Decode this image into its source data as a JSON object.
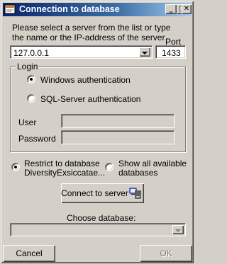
{
  "window": {
    "title": "Connection to database",
    "minimize_glyph": "_",
    "maximize_glyph": "□",
    "close_glyph": "✕"
  },
  "server": {
    "instruction": "Please select a server from the list or type the name or the IP-address of the server",
    "instruction_line1": "Please select a server from the list or type",
    "instruction_line2": "the name or the IP-address of the server",
    "value": "127.0.0.1",
    "port_label": "Port",
    "port_value": "1433"
  },
  "login": {
    "caption": "Login",
    "windows_auth_label": "Windows authentication",
    "windows_auth_selected": true,
    "sql_auth_label": "SQL-Server authentication",
    "sql_auth_selected": false,
    "user_label": "User",
    "user_value": "",
    "password_label": "Password",
    "password_value": ""
  },
  "restrict": {
    "restrict_label_line1": "Restrict to database",
    "restrict_label_line2": "DiversityExsiccatae...",
    "restrict_selected": true,
    "show_all_label_line1": "Show all available",
    "show_all_label_line2": "databases",
    "show_all_selected": false
  },
  "connect_button": {
    "label": "Connect to server"
  },
  "database": {
    "label": "Choose database:",
    "value": ""
  },
  "footer": {
    "cancel_label": "Cancel",
    "ok_label": "OK"
  },
  "icons": {
    "app": "database-login-icon",
    "connect": "server-connect-icon"
  }
}
